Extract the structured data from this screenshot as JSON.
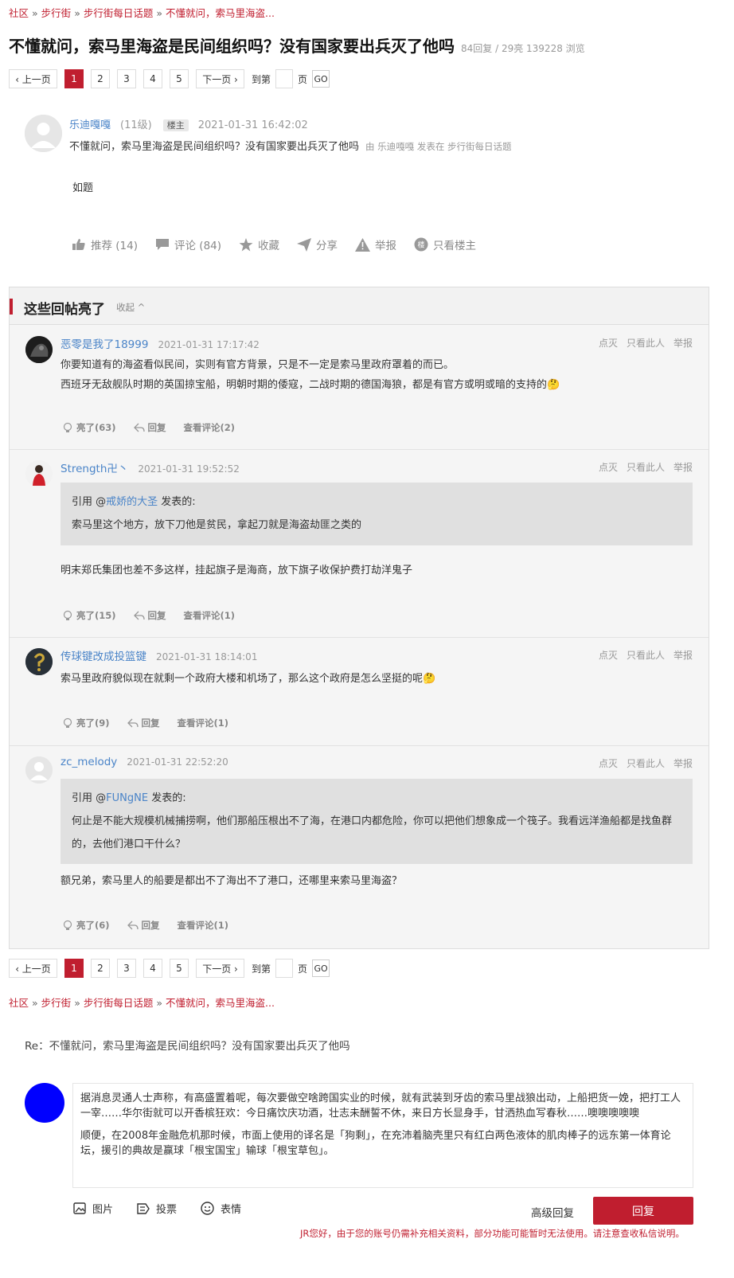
{
  "breadcrumb": {
    "items": [
      "社区",
      "步行街",
      "步行街每日话题",
      "不懂就问，索马里海盗..."
    ],
    "sep": "»"
  },
  "thread": {
    "title": "不懂就问，索马里海盗是民间组织吗？没有国家要出兵灭了他吗",
    "meta": "84回复 / 29亮 139228 浏览"
  },
  "pager": {
    "prev": "‹ 上一页",
    "pages": [
      "1",
      "2",
      "3",
      "4",
      "5"
    ],
    "current": "1",
    "next": "下一页 ›",
    "goto_label": "到第",
    "page_label": "页",
    "go": "GO"
  },
  "op": {
    "username": "乐迪嘎嘎",
    "level": "(11级)",
    "badge": "楼主",
    "time": "2021-01-31 16:42:02",
    "title_line": "不懂就问，索马里海盗是民间组织吗？没有国家要出兵灭了他吗",
    "by": "由  乐迪嘎嘎 发表在  步行街每日话题",
    "body": "如题",
    "actions": {
      "recommend": "推荐 (14)",
      "comment": "评论 (84)",
      "favorite": "收藏",
      "share": "分享",
      "report": "举报",
      "only_op": "只看楼主"
    }
  },
  "hot": {
    "title": "这些回帖亮了",
    "toggle": "收起 ^",
    "ops": {
      "dislike": "点灭",
      "only": "只看此人",
      "report": "举报"
    },
    "reply_label": "回复",
    "replies": [
      {
        "username": "恶零是我了18999",
        "time": "2021-01-31 17:17:42",
        "lines": [
          "你要知道有的海盗看似民间，实则有官方背景，只是不一定是索马里政府罩着的而已。",
          "西班牙无敌舰队时期的英国掠宝船，明朝时期的倭寇，二战时期的德国海狼，都是有官方或明或暗的支持的🤔"
        ],
        "light": "亮了(63)",
        "comments": "查看评论(2)"
      },
      {
        "username": "Strength卍丶",
        "time": "2021-01-31 19:52:52",
        "quote_prefix": "引用 @",
        "quote_user": "戒娇的大圣",
        "quote_suffix": " 发表的:",
        "quote_text": "索马里这个地方，放下刀他是贫民，拿起刀就是海盗劫匪之类的",
        "lines": [
          "明末郑氏集团也差不多这样，挂起旗子是海商，放下旗子收保护费打劫洋鬼子"
        ],
        "light": "亮了(15)",
        "comments": "查看评论(1)"
      },
      {
        "username": "传球键改成投篮键",
        "time": "2021-01-31 18:14:01",
        "lines": [
          "索马里政府貌似现在就剩一个政府大楼和机场了，那么这个政府是怎么坚挺的呢🤔"
        ],
        "light": "亮了(9)",
        "comments": "查看评论(1)"
      },
      {
        "username": "zc_melody",
        "time": "2021-01-31 22:52:20",
        "quote_prefix": "引用 @",
        "quote_user": "FUNgNE",
        "quote_suffix": " 发表的:",
        "quote_text": "何止是不能大规模机械捕捞啊，他们那船压根出不了海，在港口内都危险，你可以把他们想象成一个筏子。我看远洋渔船都是找鱼群的，去他们港口干什么？",
        "lines": [
          "额兄弟，索马里人的船要是都出不了海出不了港口，还哪里来索马里海盗？"
        ],
        "light": "亮了(6)",
        "comments": "查看评论(1)"
      }
    ]
  },
  "reply_box": {
    "title": "Re：不懂就问，索马里海盗是民间组织吗？没有国家要出兵灭了他吗",
    "paragraphs": [
      "据消息灵通人士声称，有高盛置着呢，每次要做空啥跨国实业的时候，就有武装到牙齿的索马里战狼出动，上船把货一娩，把打工人一宰……华尔街就可以开香槟狂欢：今日痛饮庆功酒，壮志未酬誓不休，来日方长显身手，甘洒热血写春秋……噢噢噢噢噢",
      "顺便，在2008年金融危机那时候，市面上使用的译名是「狗剩」，在充沛着脑壳里只有红白两色液体的肌肉棒子的远东第一体育论坛，援引的典故是赢球「根宝国宝」输球「根宝草包」。"
    ],
    "tools": {
      "image": "图片",
      "vote": "投票",
      "emoji": "表情"
    },
    "advanced": "高级回复",
    "submit": "回复",
    "notice": "JR您好，由于您的账号仍需补充相关资料，部分功能可能暂时无法使用。请注意查收私信说明。"
  },
  "colors": {
    "accent": "#c01e2f",
    "link": "#4a84c8",
    "editor_avatar": "#0000ff"
  }
}
